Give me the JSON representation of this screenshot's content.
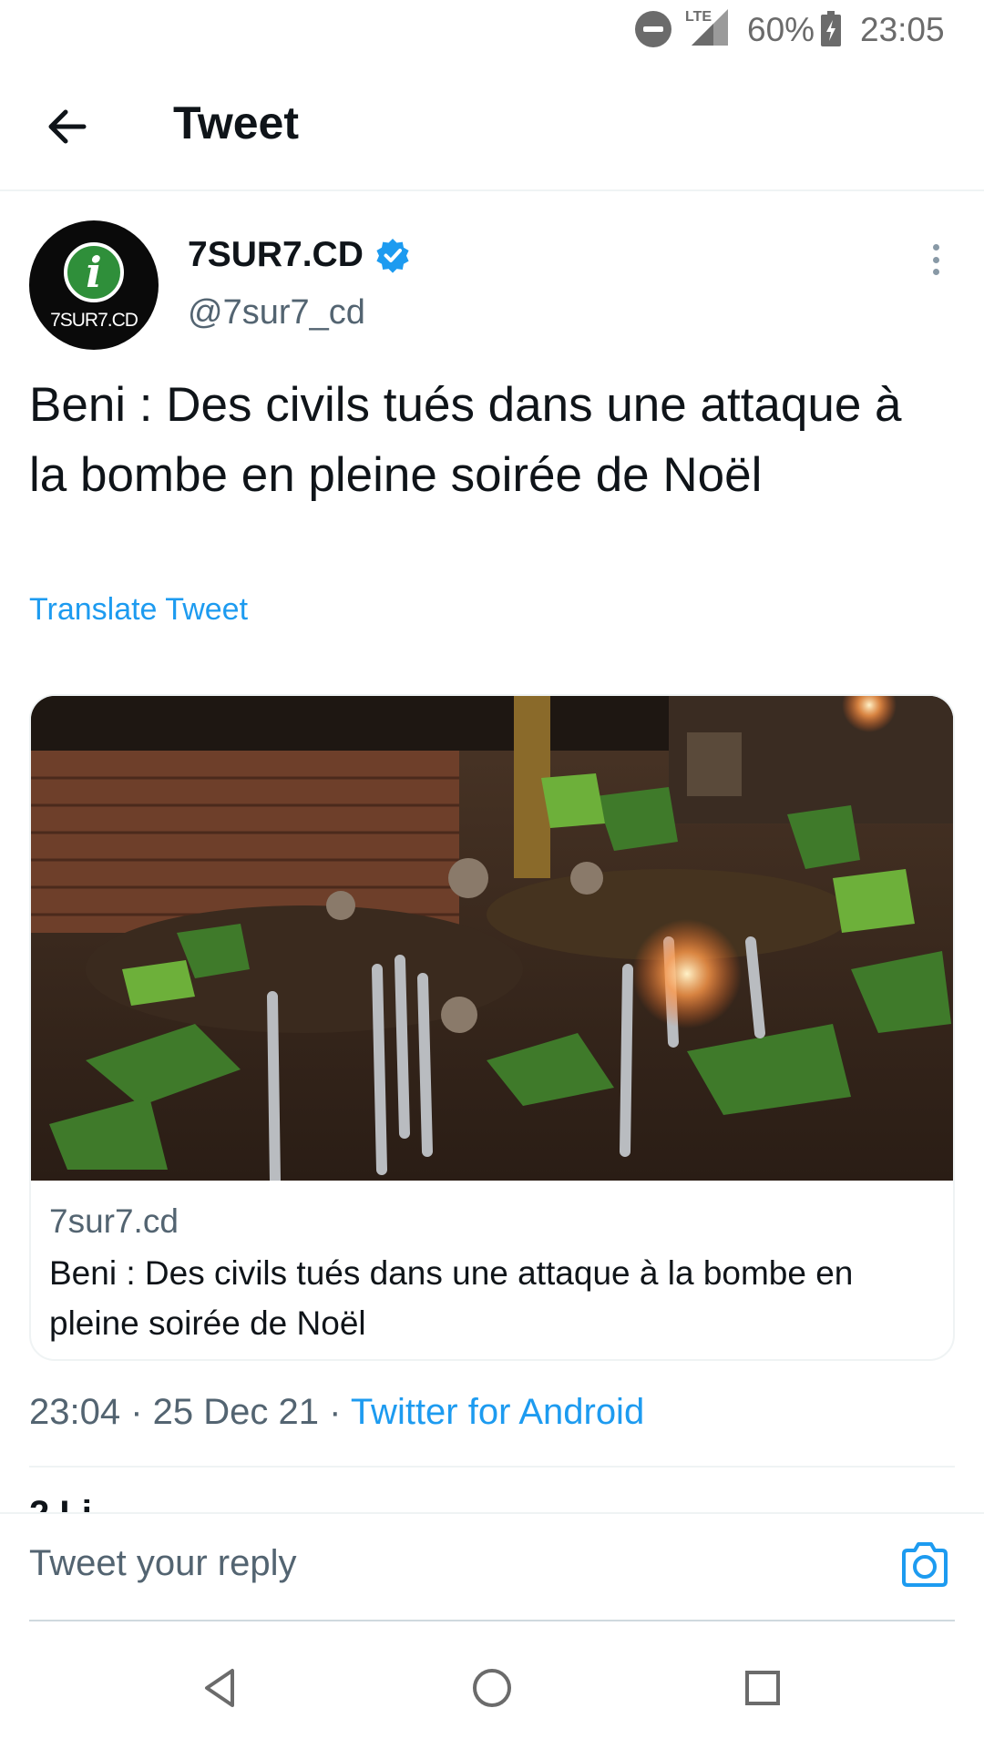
{
  "status_bar": {
    "network": "LTE",
    "battery_percent": "60%",
    "time": "23:05"
  },
  "header": {
    "title": "Tweet"
  },
  "tweet": {
    "author": {
      "name": "7SUR7.CD",
      "handle": "@7sur7_cd",
      "avatar_text": "7SUR7.CD",
      "avatar_letter": "i",
      "verified": true
    },
    "text": "Beni : Des civils tués dans une attaque à la bombe en pleine soirée de Noël",
    "translate_label": "Translate Tweet",
    "card": {
      "domain": "7sur7.cd",
      "title": "Beni : Des civils tués dans une attaque à la bombe en pleine soirée de Noël"
    },
    "meta": {
      "time": "23:04",
      "separator": " · ",
      "date": "25 Dec 21",
      "source": "Twitter for Android"
    },
    "likes_peek": "2 Li"
  },
  "reply": {
    "placeholder": "Tweet your reply"
  },
  "colors": {
    "accent": "#1d9bf0",
    "text_primary": "#0f1419",
    "text_secondary": "#536471",
    "divider": "#eff3f4",
    "avatar_green": "#2f8f3a"
  },
  "icons": {
    "back": "arrow-left-icon",
    "verified": "verified-badge-icon",
    "more": "more-vertical-icon",
    "camera": "camera-icon",
    "nav_back": "triangle-back-icon",
    "nav_home": "circle-home-icon",
    "nav_recents": "square-recents-icon"
  }
}
